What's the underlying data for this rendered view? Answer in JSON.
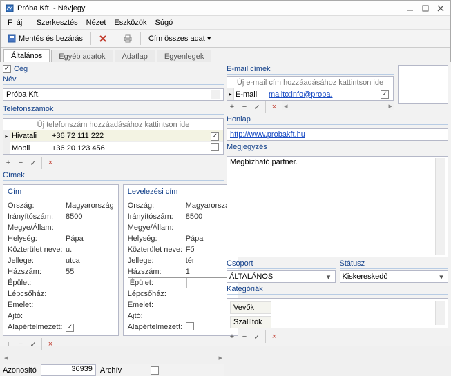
{
  "window": {
    "title": "Próba Kft. - Névjegy"
  },
  "menu": {
    "file": "Fájl",
    "edit": "Szerkesztés",
    "view": "Nézet",
    "tools": "Eszközök",
    "help": "Súgó"
  },
  "toolbar": {
    "save_close": "Mentés és bezárás",
    "addr_full": "Cím összes adat"
  },
  "tabs": {
    "general": "Általános",
    "other": "Egyéb adatok",
    "sheet": "Adatlap",
    "balances": "Egyenlegek"
  },
  "company": {
    "checkbox_label": "Cég",
    "checked": true
  },
  "name": {
    "label": "Név",
    "value": "Próba Kft."
  },
  "phones": {
    "label": "Telefonszámok",
    "placeholder": "Új telefonszám hozzáadásához kattintson ide",
    "rows": [
      {
        "type": "Hivatali",
        "number": "+36 72 111 222",
        "default": true
      },
      {
        "type": "Mobil",
        "number": "+36 20 123 456",
        "default": false
      }
    ]
  },
  "addresses": {
    "label": "Címek",
    "card1": {
      "title": "Cím",
      "orszag_l": "Ország:",
      "orszag": "Magyarország",
      "irsz_l": "Irányítószám:",
      "irsz": "8500",
      "megye_l": "Megye/Állam:",
      "helyseg_l": "Helység:",
      "helyseg": "Pápa",
      "kozt_l": "Közterület neve:",
      "kozt": "u.",
      "jelleg_l": "Jellege:",
      "jelleg": "utca",
      "haz_l": "Házszám:",
      "haz": "55",
      "epulet_l": "Épület:",
      "lepcso_l": "Lépcsőház:",
      "emelet_l": "Emelet:",
      "ajto_l": "Ajtó:",
      "default_l": "Alapértelmezett:",
      "default": true
    },
    "card2": {
      "title": "Levelezési cím",
      "orszag_l": "Ország:",
      "orszag": "Magyarország",
      "irsz_l": "Irányítószám:",
      "irsz": "8500",
      "megye_l": "Megye/Állam:",
      "helyseg_l": "Helység:",
      "helyseg": "Pápa",
      "kozt_l": "Közterület neve:",
      "kozt": "Fő",
      "jelleg_l": "Jellege:",
      "jelleg": "tér",
      "haz_l": "Házszám:",
      "haz": "1",
      "epulet_l": "Épület:",
      "lepcso_l": "Lépcsőház:",
      "emelet_l": "Emelet:",
      "ajto_l": "Ajtó:",
      "default_l": "Alapértelmezett:",
      "default": false
    }
  },
  "emails": {
    "label": "E-mail címek",
    "placeholder": "Új e-mail cím hozzáadásához kattintson ide",
    "row": {
      "type": "E-mail",
      "value": "mailto:info@proba.",
      "default": true
    }
  },
  "homepage": {
    "label": "Honlap",
    "url": "http://www.probakft.hu"
  },
  "notes": {
    "label": "Megjegyzés",
    "value": "Megbízható partner."
  },
  "group": {
    "label": "Csoport",
    "value": "ÁLTALÁNOS"
  },
  "status": {
    "label": "Státusz",
    "value": "Kiskereskedő"
  },
  "categories": {
    "label": "Kategóriák",
    "items": [
      "Vevők",
      "Szállítók"
    ]
  },
  "footer": {
    "id_label": "Azonosító",
    "id": "36939",
    "archive_label": "Archív",
    "archive": false
  }
}
